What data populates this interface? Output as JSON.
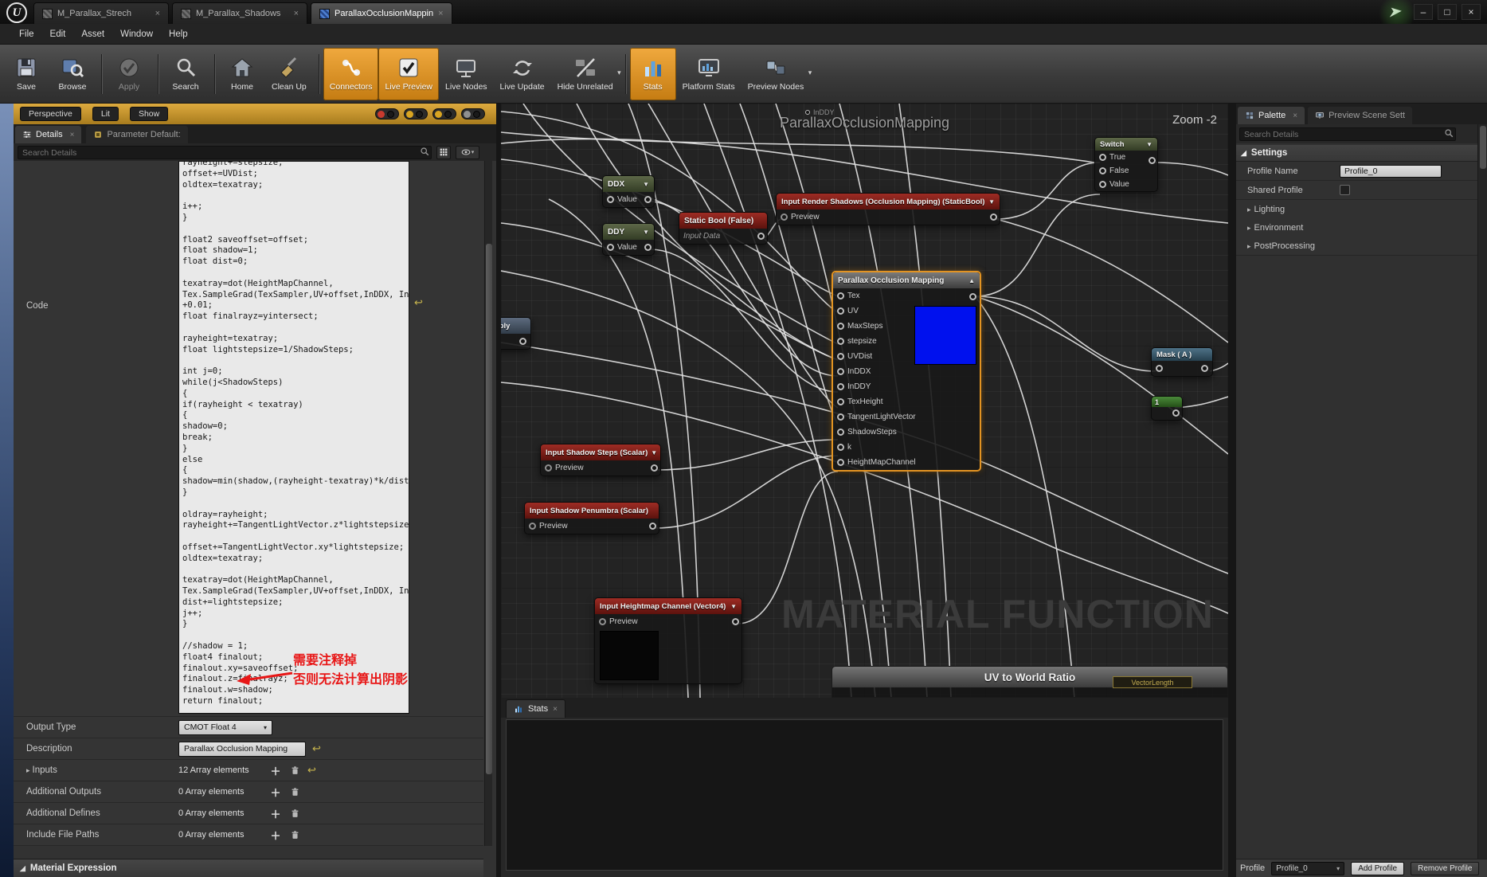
{
  "window": {
    "title_tabs": [
      {
        "label": "M_Parallax_Strech",
        "active": false
      },
      {
        "label": "M_Parallax_Shadows",
        "active": false
      },
      {
        "label": "ParallaxOcclusionMappin",
        "active": true
      }
    ],
    "menus": [
      "File",
      "Edit",
      "Asset",
      "Window",
      "Help"
    ],
    "controls": [
      {
        "name": "minimize-icon",
        "glyph": "–"
      },
      {
        "name": "maximize-icon",
        "glyph": "□"
      },
      {
        "name": "close-icon",
        "glyph": "×"
      }
    ]
  },
  "toolbar": {
    "buttons": [
      {
        "label": "Save",
        "icon": "save-icon"
      },
      {
        "label": "Browse",
        "icon": "browse-icon",
        "sep_after": true
      },
      {
        "label": "Apply",
        "icon": "apply-icon",
        "disabled": true,
        "sep_after": true
      },
      {
        "label": "Search",
        "icon": "search-icon",
        "sep_after": true
      },
      {
        "label": "Home",
        "icon": "home-icon"
      },
      {
        "label": "Clean Up",
        "icon": "clean-up-icon",
        "sep_after": true
      },
      {
        "label": "Connectors",
        "icon": "connectors-icon",
        "highlight": true
      },
      {
        "label": "Live Preview",
        "icon": "live-preview-icon",
        "highlight": true
      },
      {
        "label": "Live Nodes",
        "icon": "live-nodes-icon"
      },
      {
        "label": "Live Update",
        "icon": "live-update-icon"
      },
      {
        "label": "Hide Unrelated",
        "icon": "hide-unrelated-icon",
        "dropdown": true,
        "sep_after": true
      },
      {
        "label": "Stats",
        "icon": "stats-icon",
        "highlight": true
      },
      {
        "label": "Platform Stats",
        "icon": "platform-stats-icon"
      },
      {
        "label": "Preview Nodes",
        "icon": "preview-nodes-icon",
        "dropdown": true
      }
    ]
  },
  "viewport_strip": {
    "buttons": [
      "Perspective",
      "Lit",
      "Show"
    ]
  },
  "details": {
    "tabs": [
      {
        "label": "Details"
      },
      {
        "label": "Parameter Default:"
      }
    ],
    "search_placeholder": "Search Details",
    "code_label": "Code",
    "code": "rayheight+=stepsize;\noffset+=UVDist;\noldtex=texatray;\n\ni++;\n}\n\nfloat2 saveoffset=offset;\nfloat shadow=1;\nfloat dist=0;\n\ntexatray=dot(HeightMapChannel,\nTex.SampleGrad(TexSampler,UV+offset,InDDX, InDDY))\n+0.01;\nfloat finalrayz=yintersect;\n\nrayheight=texatray;\nfloat lightstepsize=1/ShadowSteps;\n\nint j=0;\nwhile(j<ShadowSteps)\n{\nif(rayheight < texatray)\n{\nshadow=0;\nbreak;\n}\nelse\n{\nshadow=min(shadow,(rayheight-texatray)*k/dist);\n}\n\noldray=rayheight;\nrayheight+=TangentLightVector.z*lightstepsize;\n\noffset+=TangentLightVector.xy*lightstepsize;\noldtex=texatray;\n\ntexatray=dot(HeightMapChannel,\nTex.SampleGrad(TexSampler,UV+offset,InDDX, InDDY));\ndist+=lightstepsize;\nj++;\n}\n\n//shadow = 1;\nfloat4 finalout;\nfinalout.xy=saveoffset;\nfinalout.z=finalrayz;\nfinalout.w=shadow;\nreturn finalout;",
    "annotation": {
      "line1": "需要注释掉",
      "line2": "否则无法计算出阴影"
    },
    "properties": [
      {
        "label": "Output Type",
        "value": "CMOT Float 4"
      },
      {
        "label": "Description",
        "value": "Parallax Occlusion Mapping"
      },
      {
        "label": "Inputs",
        "value": "12 Array elements"
      },
      {
        "label": "Additional Outputs",
        "value": "0 Array elements"
      },
      {
        "label": "Additional Defines",
        "value": "0 Array elements"
      },
      {
        "label": "Include File Paths",
        "value": "0 Array elements"
      }
    ],
    "section_footer": "Material Expression"
  },
  "graph": {
    "title": "ParallaxOcclusionMapping",
    "zoom_label": "Zoom -2",
    "watermark": "MATERIAL FUNCTION",
    "floating_pin_label": "InDDY",
    "nodes": {
      "ddx": {
        "title": "DDX",
        "pin": "Value"
      },
      "ddy": {
        "title": "DDY",
        "pin": "Value"
      },
      "static_bool": {
        "title": "Static Bool (False)",
        "subtitle": "Input Data"
      },
      "render_shadows": {
        "title": "Input Render Shadows (Occlusion Mapping) (StaticBool)",
        "pin": "Preview"
      },
      "parallax": {
        "title": "Parallax Occlusion Mapping",
        "pins": [
          "Tex",
          "UV",
          "MaxSteps",
          "stepsize",
          "UVDist",
          "InDDX",
          "InDDY",
          "TexHeight",
          "TangentLightVector",
          "ShadowSteps",
          "k",
          "HeightMapChannel"
        ]
      },
      "shadow_steps": {
        "title": "Input Shadow Steps (Scalar)",
        "pin": "Preview"
      },
      "shadow_penumbra": {
        "title": "Input Shadow Penumbra (Scalar)",
        "pin": "Preview"
      },
      "heightmap_channel": {
        "title": "Input Heightmap Channel (Vector4)",
        "pin": "Preview"
      },
      "switch": {
        "title": "Switch",
        "pins": [
          "True",
          "False",
          "Value"
        ]
      },
      "mask": {
        "title": "Mask ( A )"
      },
      "constant_one": {
        "title": "1"
      },
      "multiply_partial": {
        "title": "iply"
      },
      "uv_world_ratio": {
        "title": "UV to World Ratio"
      },
      "vector_length": {
        "title": "VectorLength"
      }
    }
  },
  "stats_panel": {
    "tab": "Stats"
  },
  "palette": {
    "tabs": [
      {
        "label": "Palette",
        "active": true
      },
      {
        "label": "Preview Scene Sett",
        "active": false
      }
    ],
    "search_placeholder": "Search Details",
    "settings_header": "Settings",
    "profile_name_label": "Profile Name",
    "profile_name_value": "Profile_0",
    "shared_profile_label": "Shared Profile",
    "collapsed_sections": [
      "Lighting",
      "Environment",
      "PostProcessing"
    ],
    "footer": {
      "profile_label": "Profile",
      "profile_value": "Profile_0",
      "add_button": "Add Profile",
      "remove_button": "Remove Profile"
    }
  }
}
